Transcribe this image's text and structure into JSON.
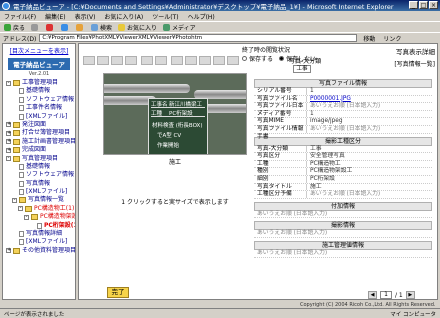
{
  "window": {
    "title": "電子納品ビューア - [C:¥Documents and Settings¥Administrator¥デスクトップ¥電子納品_1¥] - Microsoft Internet Explorer",
    "min": "_",
    "max": "□",
    "close": "×"
  },
  "menu": [
    "ファイル(F)",
    "編集(E)",
    "表示(V)",
    "お気に入り(A)",
    "ツール(T)",
    "ヘルプ(H)"
  ],
  "toolbar": {
    "back": "戻る",
    "forward": "→",
    "stop": "×",
    "refresh": "↻",
    "home": "⌂",
    "search": "検索",
    "favorites": "お気に入り",
    "media": "メディア"
  },
  "address": {
    "label": "アドレス(D)",
    "value": "C:¥Program Files¥PhotXML¥ViewerXML¥Viewer¥Photohtm",
    "go": "移動",
    "links": "リンク"
  },
  "sidebar": {
    "header": "[目次メニューを表示]",
    "brand": "電子納品ビューア",
    "version": "Ver.2.01",
    "items": [
      {
        "label": "工事管理項目",
        "box": "-",
        "level": 0,
        "folder": true
      },
      {
        "label": "基礎情報",
        "level": 1
      },
      {
        "label": "ソフトウェア情報",
        "level": 1
      },
      {
        "label": "工事件名情報",
        "level": 1
      },
      {
        "label": "[XMLファイル]",
        "level": 1
      },
      {
        "label": "発注図面",
        "box": "+",
        "level": 0,
        "folder": true
      },
      {
        "label": "打合せ簿管理項目",
        "box": "+",
        "level": 0,
        "folder": true
      },
      {
        "label": "施工計画書管理項目",
        "box": "+",
        "level": 0,
        "folder": true
      },
      {
        "label": "完成図面",
        "box": "+",
        "level": 0,
        "folder": true
      },
      {
        "label": "写真管理項目",
        "box": "-",
        "level": 0,
        "folder": true
      },
      {
        "label": "基礎情報",
        "level": 1
      },
      {
        "label": "ソフトウェア情報",
        "level": 1
      },
      {
        "label": "写真情報",
        "level": 1
      },
      {
        "label": "[XMLファイル]",
        "level": 1
      },
      {
        "label": "写真情報一覧",
        "box": "-",
        "level": 1,
        "folder": true
      },
      {
        "label": "PC構造物工(1)",
        "box": "-",
        "level": 2,
        "folder": true,
        "style": "red"
      },
      {
        "label": "PC構造物架設工(1)",
        "box": "-",
        "level": 3,
        "folder": true,
        "style": "red"
      },
      {
        "label": "PC桁架設(1)",
        "level": 4,
        "style": "sel"
      },
      {
        "label": "写真情報詳細",
        "level": 1
      },
      {
        "label": "[XMLファイル]",
        "level": 1
      },
      {
        "label": "その他資料管理項目",
        "box": "+",
        "level": 0,
        "folder": true
      }
    ]
  },
  "toggles": {
    "label": "終了時の閲覧状況",
    "opt1": "保存する",
    "opt2": "保存しない",
    "opt1_on": false,
    "opt2_on": true
  },
  "typebox": {
    "label": "写真-大分類",
    "value": "工事"
  },
  "doc": {
    "title": "写真表示詳細",
    "subtitle": "[写真情報一覧]"
  },
  "photo": {
    "board_lines": [
      "工事名",
      "新江川橋梁工",
      "工種",
      "PC桁架設",
      "材料検査 (桁長BOX)",
      "でA型 CV",
      "作業開始"
    ],
    "caption": "施工"
  },
  "hint": "1 クリックすると実サイズで表示します",
  "panel": {
    "sec1": "写真ファイル情報",
    "rows1": [
      {
        "k": "シリアル番号",
        "v": "1",
        "cls": ""
      },
      {
        "k": "写真ファイル名",
        "v": "P0000001.JPG",
        "cls": "link"
      },
      {
        "k": "写真ファイル日本語名",
        "v": "あいうえお順 (日本語入力)",
        "cls": "hint"
      },
      {
        "k": "メディア番号",
        "v": "1",
        "cls": ""
      },
      {
        "k": "写真MIME",
        "v": "image/jpeg",
        "cls": ""
      },
      {
        "k": "写真ファイル情報手書",
        "v": "あいうえお順 (日本語入力)",
        "cls": "hint"
      }
    ],
    "sec2": "撮影工種区分",
    "rows2": [
      {
        "k": "写真-大分類",
        "v": "工事",
        "cls": ""
      },
      {
        "k": "写真区分",
        "v": "安全管理写真",
        "cls": ""
      },
      {
        "k": "工種",
        "v": "PC構造物工",
        "cls": ""
      },
      {
        "k": "種別",
        "v": "PC構造物架設工",
        "cls": ""
      },
      {
        "k": "細別",
        "v": "PC桁架設",
        "cls": ""
      },
      {
        "k": "写真タイトル",
        "v": "施工",
        "cls": ""
      },
      {
        "k": "工種区分予備",
        "v": "あいうえお順 (日本語入力)",
        "cls": "hint"
      }
    ],
    "sec3": "付加情報",
    "blank3": "あいうえお順 (日本語入力)",
    "sec4": "撮影情報",
    "blank4": "あいうえお順 (日本語入力)",
    "sec5": "施工管理値情報",
    "blank5": "あいうえお順 (日本語入力)"
  },
  "done": "完了",
  "pager": {
    "current": "1",
    "total": "/ 1",
    "prev": "◀",
    "next": "▶"
  },
  "copyright": "Copyright (C) 2004 Ricoh Co.,Ltd. All Rights Reserved.",
  "status": {
    "left": "ページが表示されました",
    "zone": "マイ コンピュータ"
  },
  "colors": {
    "accent": "#2c6ab0",
    "title": "#0a246a",
    "done": "#f6d34a"
  }
}
